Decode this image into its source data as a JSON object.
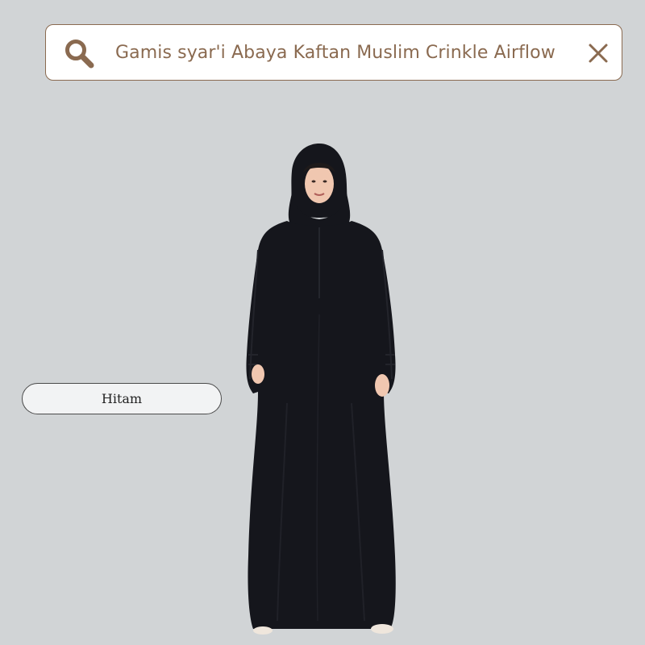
{
  "search": {
    "query": "Gamis syar'i Abaya Kaftan Muslim Crinkle Airflow",
    "icon": "search-icon",
    "clear_icon": "close-icon"
  },
  "variant": {
    "selected_label": "Hitam"
  },
  "colors": {
    "background": "#d1d4d6",
    "accent": "#8a6a50",
    "garment": "#15161c"
  }
}
